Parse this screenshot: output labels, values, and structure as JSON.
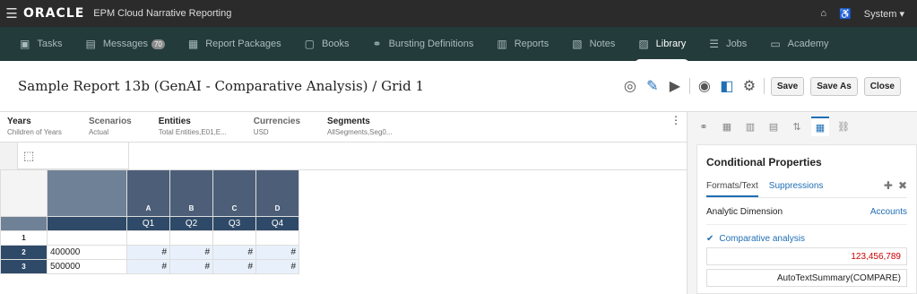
{
  "topbar": {
    "brand": "ORACLE",
    "product": "EPM Cloud Narrative Reporting",
    "user": "System ▾"
  },
  "nav": [
    {
      "icon": "▣",
      "label": "Tasks"
    },
    {
      "icon": "▤",
      "label": "Messages",
      "badge": "70"
    },
    {
      "icon": "▦",
      "label": "Report Packages"
    },
    {
      "icon": "▢",
      "label": "Books"
    },
    {
      "icon": "⚭",
      "label": "Bursting Definitions"
    },
    {
      "icon": "▥",
      "label": "Reports"
    },
    {
      "icon": "▧",
      "label": "Notes"
    },
    {
      "icon": "▨",
      "label": "Library",
      "active": true
    },
    {
      "icon": "☰",
      "label": "Jobs"
    },
    {
      "icon": "▭",
      "label": "Academy"
    }
  ],
  "title": "Sample Report 13b (GenAI - Comparative Analysis) / Grid 1",
  "buttons": {
    "save": "Save",
    "save_as": "Save As",
    "close": "Close"
  },
  "pov": [
    {
      "header": "Years",
      "value": "Children of Years",
      "dim": false
    },
    {
      "header": "Scenarios",
      "value": "Actual",
      "dim": true
    },
    {
      "header": "Entities",
      "value": "Total Entities,E01,E...",
      "dim": false
    },
    {
      "header": "Currencies",
      "value": "USD",
      "dim": true
    },
    {
      "header": "Segments",
      "value": "AllSegments,Seg0...",
      "dim": false
    }
  ],
  "grid": {
    "col_letters": [
      "A",
      "B",
      "C",
      "D"
    ],
    "col_headers": [
      "Q1",
      "Q2",
      "Q3",
      "Q4"
    ],
    "rows": [
      {
        "num": "1",
        "label": "",
        "cells": [
          "",
          "",
          "",
          ""
        ]
      },
      {
        "num": "2",
        "label": "400000",
        "cells": [
          "#",
          "#",
          "#",
          "#"
        ]
      },
      {
        "num": "3",
        "label": "500000",
        "cells": [
          "#",
          "#",
          "#",
          "#"
        ]
      }
    ]
  },
  "panel": {
    "title": "Conditional Properties",
    "tab_formats": "Formats/Text",
    "tab_suppressions": "Suppressions",
    "dimension_label": "Analytic Dimension",
    "dimension_value": "Accounts",
    "condition": "Comparative analysis",
    "number_value": "123,456,789",
    "formula": "AutoTextSummary(COMPARE)"
  },
  "colors": {
    "accent": "#1f6fb5",
    "header_dark": "#4d5e78",
    "header_darker": "#2f4a68",
    "row_dark": "#2f4a68",
    "red": "#cc0000"
  }
}
